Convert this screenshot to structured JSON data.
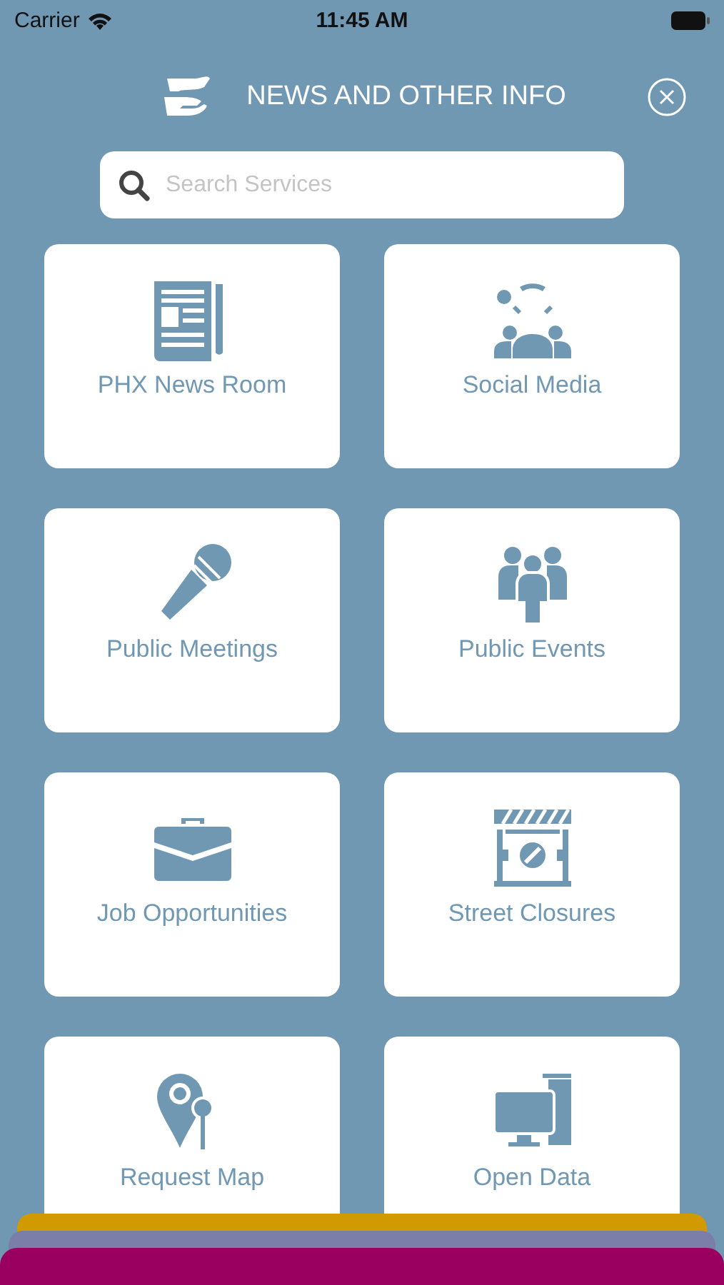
{
  "status_bar": {
    "carrier": "Carrier",
    "time": "11:45 AM"
  },
  "header": {
    "title": "NEWS AND OTHER INFO"
  },
  "search": {
    "placeholder": "Search Services"
  },
  "tiles": [
    {
      "label": "PHX News Room",
      "kind": "newspaper"
    },
    {
      "label": "Social Media",
      "kind": "social"
    },
    {
      "label": "Public Meetings",
      "kind": "microphone"
    },
    {
      "label": "Public Events",
      "kind": "people"
    },
    {
      "label": "Job Opportunities",
      "kind": "briefcase"
    },
    {
      "label": "Street Closures",
      "kind": "barrier"
    },
    {
      "label": "Request Map",
      "kind": "map-pin"
    },
    {
      "label": "Open Data",
      "kind": "computer"
    }
  ],
  "bottom_sheets": [
    {
      "color": "#d19a00"
    },
    {
      "color": "#7a7ea8"
    },
    {
      "color": "#990060"
    }
  ]
}
